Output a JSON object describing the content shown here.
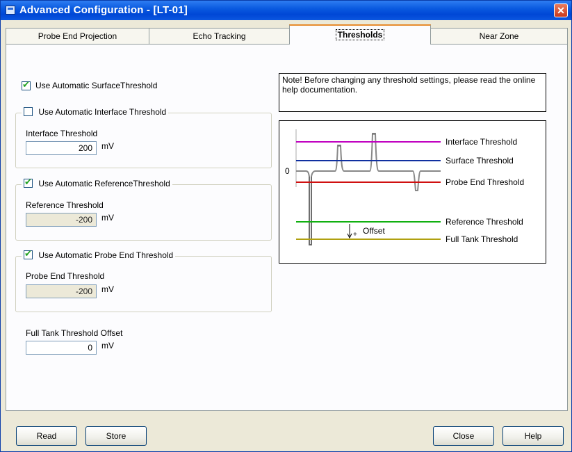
{
  "window": {
    "title": "Advanced Configuration - [LT-01]",
    "close_glyph": "✕"
  },
  "tabs": [
    {
      "label": "Probe End Projection",
      "active": false
    },
    {
      "label": "Echo Tracking",
      "active": false
    },
    {
      "label": "Thresholds",
      "active": true
    },
    {
      "label": "Near Zone",
      "active": false
    }
  ],
  "surface": {
    "checkbox_label": "Use Automatic SurfaceThreshold",
    "checked": true
  },
  "interface": {
    "checkbox_label": "Use Automatic Interface Threshold",
    "checked": false,
    "field_label": "Interface Threshold",
    "value": "200",
    "unit": "mV"
  },
  "reference": {
    "checkbox_label": "Use Automatic ReferenceThreshold",
    "checked": true,
    "field_label": "Reference Threshold",
    "value": "-200",
    "unit": "mV"
  },
  "probe_end": {
    "checkbox_label": "Use Automatic Probe End Threshold",
    "checked": true,
    "field_label": "Probe End Threshold",
    "value": "-200",
    "unit": "mV"
  },
  "full_tank": {
    "field_label": "Full Tank Threshold Offset",
    "value": "0",
    "unit": "mV"
  },
  "note": "Note! Before changing any threshold settings, please read the online help documentation.",
  "diagram": {
    "zero_label": "0",
    "offset_label": "Offset",
    "lines": [
      {
        "label": "Interface Threshold",
        "color": "#c000c0"
      },
      {
        "label": "Surface Threshold",
        "color": "#1030a0"
      },
      {
        "label": "Probe End Threshold",
        "color": "#d01010"
      },
      {
        "label": "Reference Threshold",
        "color": "#10b010"
      },
      {
        "label": "Full Tank Threshold",
        "color": "#b0a010"
      }
    ]
  },
  "buttons": {
    "read": "Read",
    "store": "Store",
    "close": "Close",
    "help": "Help"
  }
}
